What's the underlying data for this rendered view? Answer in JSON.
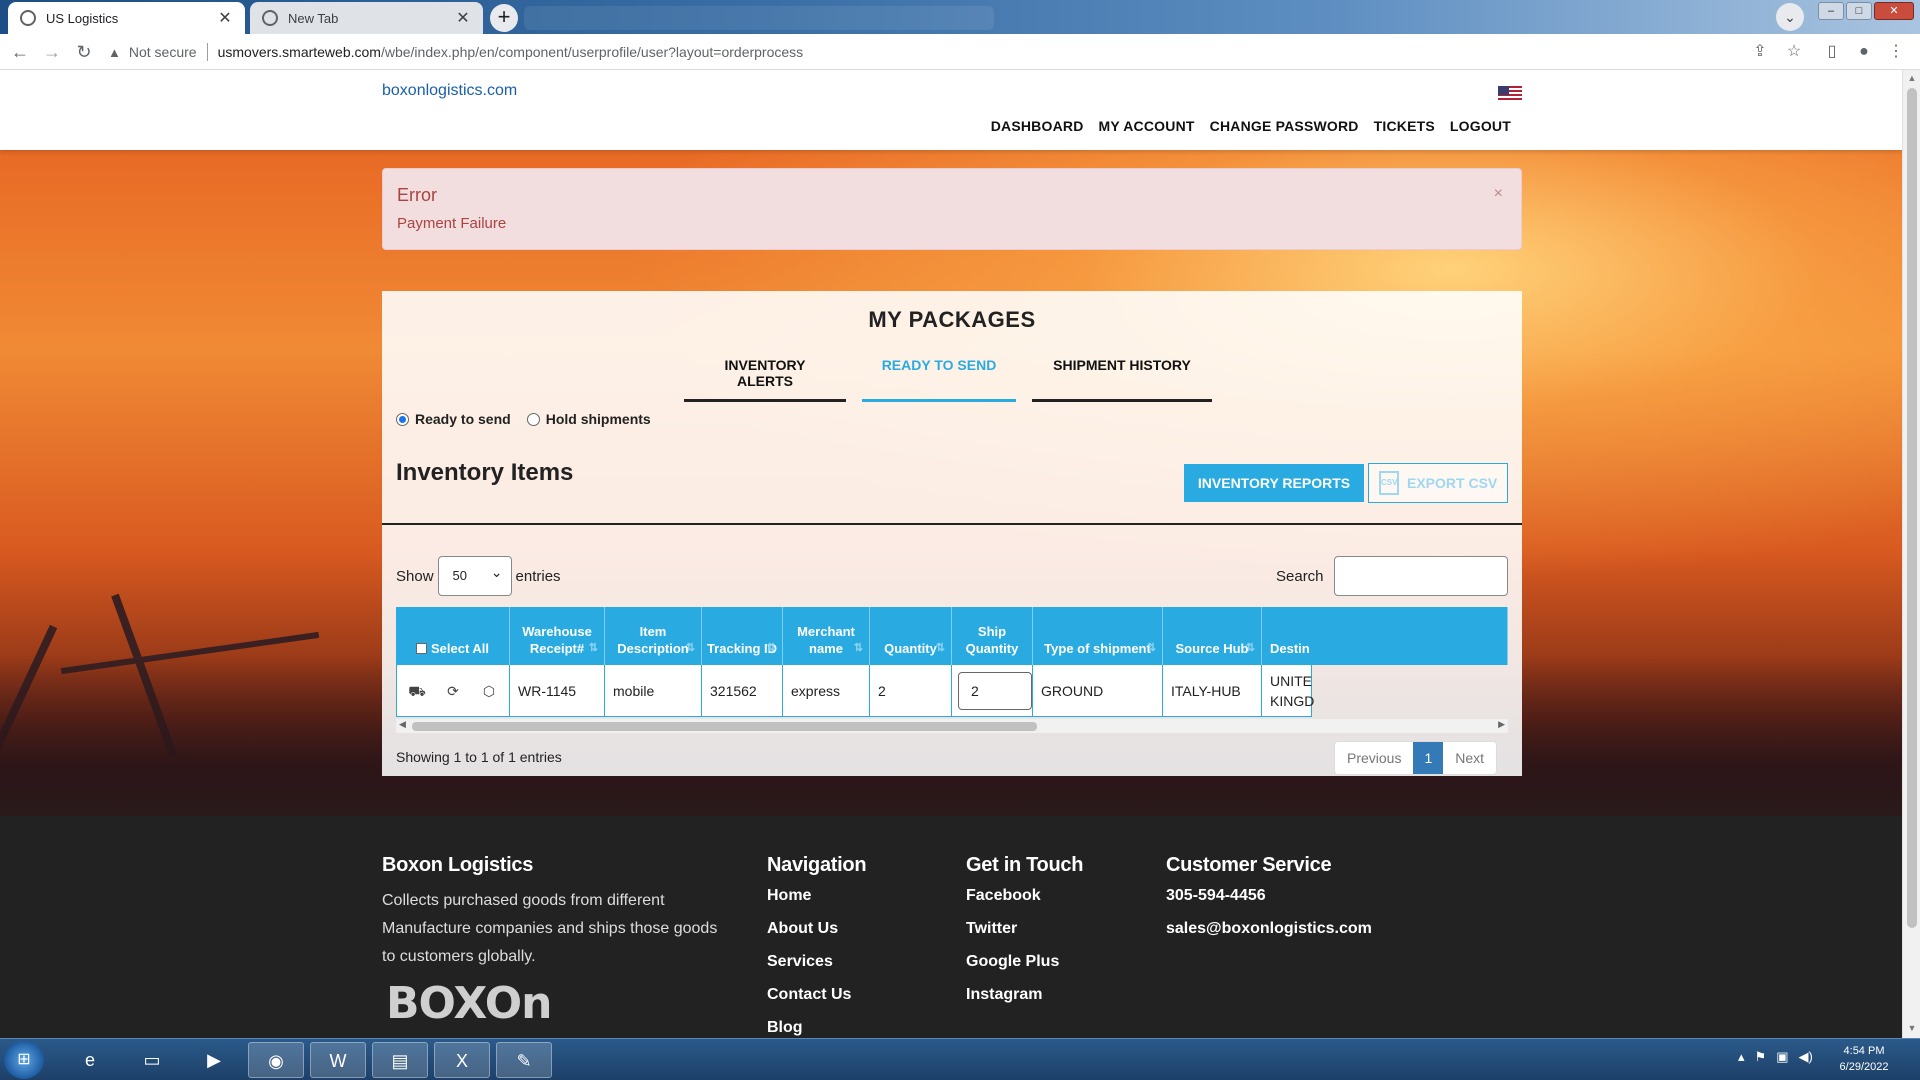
{
  "browser": {
    "tabs": [
      {
        "title": "US Logistics",
        "active": true
      },
      {
        "title": "New Tab",
        "active": false
      }
    ],
    "security_label": "Not secure",
    "url_host": "usmovers.smarteweb.com",
    "url_path": "/wbe/index.php/en/component/userprofile/user?layout=orderprocess"
  },
  "header": {
    "logo_alt": "boxonlogistics.com",
    "nav": [
      "DASHBOARD",
      "MY ACCOUNT",
      "CHANGE PASSWORD",
      "TICKETS",
      "LOGOUT"
    ]
  },
  "alert": {
    "title": "Error",
    "message": "Payment Failure",
    "close": "×"
  },
  "packages": {
    "heading": "MY PACKAGES",
    "tabs": [
      "INVENTORY ALERTS",
      "READY TO SEND",
      "SHIPMENT HISTORY"
    ],
    "active_tab": "READY TO SEND",
    "radios": [
      {
        "label": "Ready to send",
        "checked": true
      },
      {
        "label": "Hold shipments",
        "checked": false
      }
    ],
    "section_title": "Inventory Items",
    "reports_button": "INVENTORY REPORTS",
    "export_button": "EXPORT CSV",
    "show_label": "Show",
    "entries_value": "50",
    "entries_label": "entries",
    "search_label": "Search",
    "columns": [
      "Select All",
      "Warehouse Receipt#",
      "Item Description",
      "Tracking ID",
      "Merchant name",
      "Quantity",
      "Ship Quantity",
      "Type of shipment",
      "Source Hub",
      "Destin"
    ],
    "rows": [
      {
        "receipt": "WR-1145",
        "description": "mobile",
        "tracking": "321562",
        "merchant": "express",
        "quantity": "2",
        "ship_quantity": "2",
        "shipment_type": "GROUND",
        "source_hub": "ITALY-HUB",
        "destination": "UNITE KINGD"
      }
    ],
    "showing_text": "Showing 1 to 1 of 1 entries",
    "pager": {
      "prev": "Previous",
      "current": "1",
      "next": "Next"
    }
  },
  "footer": {
    "brand_title": "Boxon Logistics",
    "brand_desc": "Collects purchased goods from different Manufacture companies and ships those goods to customers globally.",
    "brand_logo_text": "BOXOn",
    "nav_title": "Navigation",
    "nav_links": [
      "Home",
      "About Us",
      "Services",
      "Contact Us",
      "Blog"
    ],
    "touch_title": "Get in Touch",
    "touch_links": [
      "Facebook",
      "Twitter",
      "Google Plus",
      "Instagram"
    ],
    "service_title": "Customer Service",
    "phone": "305-594-4456",
    "email": "sales@boxonlogistics.com"
  },
  "taskbar": {
    "time": "4:54 PM",
    "date": "6/29/2022"
  },
  "colors": {
    "accent": "#29abe2",
    "alert_bg": "#f2dede",
    "alert_text": "#a94442",
    "footer_bg": "#222222"
  }
}
